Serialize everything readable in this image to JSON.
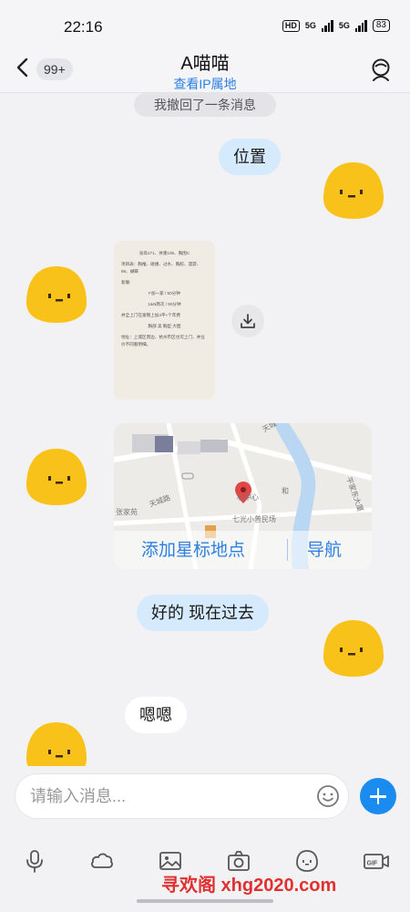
{
  "status_bar": {
    "time": "22:16",
    "hd_label": "HD",
    "sim1_label": "5G",
    "sim2_label": "5G",
    "battery": "83"
  },
  "header": {
    "back_icon": "chevron-left-icon",
    "unread_badge": "99+",
    "title": "A喵喵",
    "subtitle": "查看IP属地",
    "profile_icon": "person-icon"
  },
  "messages": {
    "recall_notice": "我撤回了一条消息",
    "msg_location_text": "位置",
    "image_card_lines": [
      "身高171、体重105、胸围C",
      "项目表：胸推、碰撞、过水、胸胶、漫游、69、蝴蝶",
      "套餐:",
      "F加一家 / 50分钟",
      "1&N两次 / 90分钟",
      "并全上门在富锦上加4平+个年费",
      "胸部 美 胸型 大胆",
      "地址：上城区周边、杭州市区也可上门、并业价不同看明细。"
    ],
    "download_icon": "download-icon",
    "map_labels": [
      "天城",
      "心中心",
      "和",
      "七光小普民场",
      "张家苑",
      "平家东大厦",
      "天城路"
    ],
    "map_action_add": "添加星标地点",
    "map_action_nav": "导航",
    "msg_reply": "好的 现在过去",
    "msg_ok": "嗯嗯"
  },
  "input_bar": {
    "placeholder": "请输入消息...",
    "emoji_icon": "smiley-icon",
    "plus_icon": "plus-icon"
  },
  "toolbar": {
    "icons": [
      "microphone-icon",
      "cloud-icon",
      "image-icon",
      "camera-icon",
      "sticker-face-icon",
      "gif-icon"
    ]
  },
  "watermark": "寻欢阁 xhg2020.com",
  "colors": {
    "accent": "#2d7fe0",
    "my_bubble": "#d5eafc",
    "their_bubble": "#ffffff",
    "avatar_yellow": "#f9c21a",
    "watermark_red": "#e03030"
  }
}
